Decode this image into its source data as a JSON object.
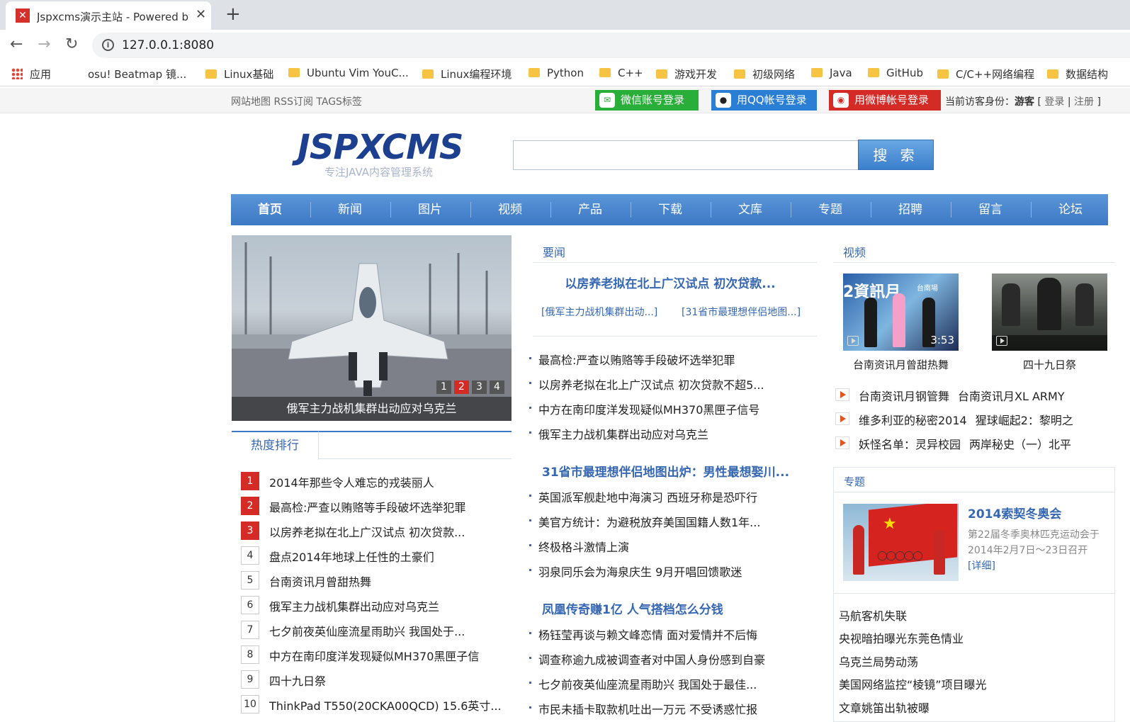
{
  "browser": {
    "tab_title": "Jspxcms演示主站 - Powered by",
    "tab_icon": "jspxcms-favicon",
    "url": "127.0.0.1:8080",
    "bookmarks": [
      "应用",
      "osu! Beatmap 镜...",
      "Linux基础",
      "Ubuntu Vim YouC...",
      "Linux编程环境",
      "Python",
      "C++",
      "游戏开发",
      "初级网络",
      "Java",
      "GitHub",
      "C/C++网络编程",
      "数据结构"
    ]
  },
  "topbar": {
    "links": "网站地图 RSS订阅 TAGS标签",
    "wechat_login": "微信账号登录",
    "qq_login": "用QQ帐号登录",
    "weibo_login": "用微博帐号登录",
    "visitor_label": "当前访客身份：",
    "visitor_name": "游客",
    "login": "登录",
    "register": "注册",
    "wechat_color": "#2aae3a",
    "qq_color": "#2a7fd4",
    "weibo_color": "#d52b27"
  },
  "logo": {
    "main": "JSPXCMS",
    "sub": "专注JAVA内容管理系统"
  },
  "search": {
    "button": "搜 索",
    "placeholder": ""
  },
  "nav": [
    "首页",
    "新闻",
    "图片",
    "视频",
    "产品",
    "下载",
    "文库",
    "专题",
    "招聘",
    "留言",
    "论坛"
  ],
  "slideshow": {
    "caption": "俄军主力战机集群出动应对乌克兰",
    "pages": [
      "1",
      "2",
      "3",
      "4"
    ],
    "active_page": "2"
  },
  "hot": {
    "title": "热度排行",
    "items": [
      {
        "n": "1",
        "t": "2014年那些令人难忘的戎装丽人"
      },
      {
        "n": "2",
        "t": "最高检:严查以贿赂等手段破坏选举犯罪"
      },
      {
        "n": "3",
        "t": "以房养老拟在北上广汉试点 初次贷款..."
      },
      {
        "n": "4",
        "t": "盘点2014年地球上任性的土豪们"
      },
      {
        "n": "5",
        "t": "台南资讯月曾甜热舞"
      },
      {
        "n": "6",
        "t": "俄军主力战机集群出动应对乌克兰"
      },
      {
        "n": "7",
        "t": "七夕前夜英仙座流星雨助兴 我国处于..."
      },
      {
        "n": "8",
        "t": "中方在南印度洋发现疑似MH370黑匣子信"
      },
      {
        "n": "9",
        "t": "四十九日祭"
      },
      {
        "n": "10",
        "t": "ThinkPad T550(20CKA00QCD) 15.6英寸..."
      }
    ]
  },
  "news": {
    "title": "要闻",
    "lead": "以房养老拟在北上广汉试点 初次贷款...",
    "sub_left": "[俄军主力战机集群出动...]",
    "sub_right": "[31省市最理想伴侣地图...]",
    "group1": [
      "最高检:严查以贿赂等手段破坏选举犯罪",
      "以房养老拟在北上广汉试点 初次贷款不超5...",
      "中方在南印度洋发现疑似MH370黑匣子信号",
      "俄军主力战机集群出动应对乌克兰"
    ],
    "headline2": "31省市最理想伴侣地图出炉：男性最想娶川...",
    "group2": [
      "英国派军舰赴地中海演习 西班牙称是恐吓行",
      "美官方统计：为避税放弃美国国籍人数1年...",
      "终极格斗激情上演",
      "羽泉同乐会为海泉庆生 9月开唱回馈歌迷"
    ],
    "headline3": "凤凰传奇赚1亿 人气搭档怎么分钱",
    "group3": [
      "杨钰莹再谈与赖文峰恋情 面对爱情并不后悔",
      "调查称逾九成被调查者对中国人身份感到自豪",
      "七夕前夜英仙座流星雨助兴 我国处于最佳...",
      "市民未插卡取款机吐出一万元 不受诱惑忙报"
    ]
  },
  "video": {
    "title": "视频",
    "thumbs": [
      {
        "caption": "台南资讯月曾甜热舞",
        "duration": "3:53",
        "overlay": "2資訊月",
        "overlay2": "台南場"
      },
      {
        "caption": "四十九日祭",
        "duration": "",
        "overlay": "",
        "overlay2": ""
      }
    ],
    "rows": [
      [
        "台南资讯月钢管舞",
        "台南资讯月XL ARMY"
      ],
      [
        "维多利亚的秘密2014",
        "猩球崛起2：黎明之"
      ],
      [
        "妖怪名单：灵异校园",
        "两岸秘史（一）北平"
      ]
    ]
  },
  "topic": {
    "title": "专题",
    "feature_title": "2014索契冬奥会",
    "feature_desc": "第22届冬季奥林匹克运动会于2014年2月7日～23日召开",
    "feature_more": "[详细]",
    "list": [
      "马航客机失联",
      "央视暗拍曝光东莞色情业",
      "乌克兰局势动荡",
      "美国网络监控“棱镜”项目曝光",
      "文章姚笛出轨被曝"
    ]
  }
}
